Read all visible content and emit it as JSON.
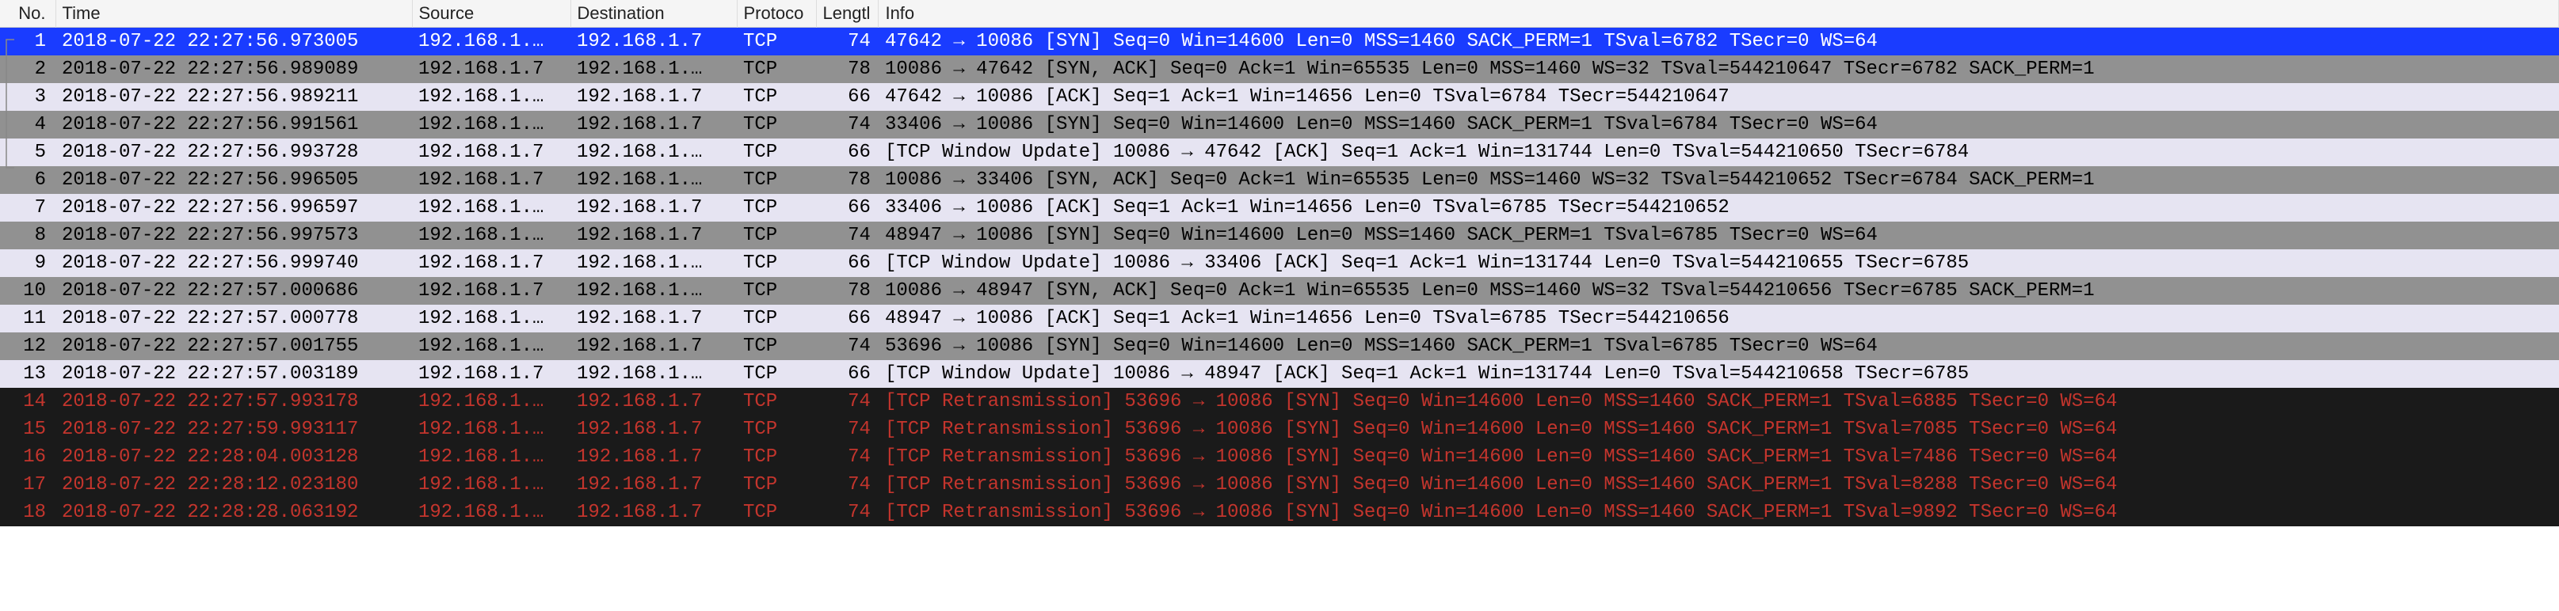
{
  "columns": {
    "no": "No.",
    "time": "Time",
    "source": "Source",
    "destination": "Destination",
    "protocol": "Protoco",
    "length": "Lengtl",
    "info": "Info"
  },
  "rows": [
    {
      "no": "1",
      "time": "2018-07-22 22:27:56.973005",
      "src": "192.168.1.…",
      "dst": "192.168.1.7",
      "proto": "TCP",
      "len": "74",
      "info": "47642 → 10086 [SYN] Seq=0 Win=14600 Len=0 MSS=1460 SACK_PERM=1 TSval=6782 TSecr=0 WS=64",
      "style": "selected"
    },
    {
      "no": "2",
      "time": "2018-07-22 22:27:56.989089",
      "src": "192.168.1.7",
      "dst": "192.168.1.…",
      "proto": "TCP",
      "len": "78",
      "info": "10086 → 47642 [SYN, ACK] Seq=0 Ack=1 Win=65535 Len=0 MSS=1460 WS=32 TSval=544210647 TSecr=6782 SACK_PERM=1",
      "style": "gray"
    },
    {
      "no": "3",
      "time": "2018-07-22 22:27:56.989211",
      "src": "192.168.1.…",
      "dst": "192.168.1.7",
      "proto": "TCP",
      "len": "66",
      "info": "47642 → 10086 [ACK] Seq=1 Ack=1 Win=14656 Len=0 TSval=6784 TSecr=544210647",
      "style": "light"
    },
    {
      "no": "4",
      "time": "2018-07-22 22:27:56.991561",
      "src": "192.168.1.…",
      "dst": "192.168.1.7",
      "proto": "TCP",
      "len": "74",
      "info": "33406 → 10086 [SYN] Seq=0 Win=14600 Len=0 MSS=1460 SACK_PERM=1 TSval=6784 TSecr=0 WS=64",
      "style": "gray"
    },
    {
      "no": "5",
      "time": "2018-07-22 22:27:56.993728",
      "src": "192.168.1.7",
      "dst": "192.168.1.…",
      "proto": "TCP",
      "len": "66",
      "info": "[TCP Window Update] 10086 → 47642 [ACK] Seq=1 Ack=1 Win=131744 Len=0 TSval=544210650 TSecr=6784",
      "style": "light"
    },
    {
      "no": "6",
      "time": "2018-07-22 22:27:56.996505",
      "src": "192.168.1.7",
      "dst": "192.168.1.…",
      "proto": "TCP",
      "len": "78",
      "info": "10086 → 33406 [SYN, ACK] Seq=0 Ack=1 Win=65535 Len=0 MSS=1460 WS=32 TSval=544210652 TSecr=6784 SACK_PERM=1",
      "style": "gray"
    },
    {
      "no": "7",
      "time": "2018-07-22 22:27:56.996597",
      "src": "192.168.1.…",
      "dst": "192.168.1.7",
      "proto": "TCP",
      "len": "66",
      "info": "33406 → 10086 [ACK] Seq=1 Ack=1 Win=14656 Len=0 TSval=6785 TSecr=544210652",
      "style": "light"
    },
    {
      "no": "8",
      "time": "2018-07-22 22:27:56.997573",
      "src": "192.168.1.…",
      "dst": "192.168.1.7",
      "proto": "TCP",
      "len": "74",
      "info": "48947 → 10086 [SYN] Seq=0 Win=14600 Len=0 MSS=1460 SACK_PERM=1 TSval=6785 TSecr=0 WS=64",
      "style": "gray"
    },
    {
      "no": "9",
      "time": "2018-07-22 22:27:56.999740",
      "src": "192.168.1.7",
      "dst": "192.168.1.…",
      "proto": "TCP",
      "len": "66",
      "info": "[TCP Window Update] 10086 → 33406 [ACK] Seq=1 Ack=1 Win=131744 Len=0 TSval=544210655 TSecr=6785",
      "style": "light"
    },
    {
      "no": "10",
      "time": "2018-07-22 22:27:57.000686",
      "src": "192.168.1.7",
      "dst": "192.168.1.…",
      "proto": "TCP",
      "len": "78",
      "info": "10086 → 48947 [SYN, ACK] Seq=0 Ack=1 Win=65535 Len=0 MSS=1460 WS=32 TSval=544210656 TSecr=6785 SACK_PERM=1",
      "style": "gray"
    },
    {
      "no": "11",
      "time": "2018-07-22 22:27:57.000778",
      "src": "192.168.1.…",
      "dst": "192.168.1.7",
      "proto": "TCP",
      "len": "66",
      "info": "48947 → 10086 [ACK] Seq=1 Ack=1 Win=14656 Len=0 TSval=6785 TSecr=544210656",
      "style": "light"
    },
    {
      "no": "12",
      "time": "2018-07-22 22:27:57.001755",
      "src": "192.168.1.…",
      "dst": "192.168.1.7",
      "proto": "TCP",
      "len": "74",
      "info": "53696 → 10086 [SYN] Seq=0 Win=14600 Len=0 MSS=1460 SACK_PERM=1 TSval=6785 TSecr=0 WS=64",
      "style": "gray"
    },
    {
      "no": "13",
      "time": "2018-07-22 22:27:57.003189",
      "src": "192.168.1.7",
      "dst": "192.168.1.…",
      "proto": "TCP",
      "len": "66",
      "info": "[TCP Window Update] 10086 → 48947 [ACK] Seq=1 Ack=1 Win=131744 Len=0 TSval=544210658 TSecr=6785",
      "style": "light"
    },
    {
      "no": "14",
      "time": "2018-07-22 22:27:57.993178",
      "src": "192.168.1.…",
      "dst": "192.168.1.7",
      "proto": "TCP",
      "len": "74",
      "info": "[TCP Retransmission] 53696 → 10086 [SYN] Seq=0 Win=14600 Len=0 MSS=1460 SACK_PERM=1 TSval=6885 TSecr=0 WS=64",
      "style": "retrans"
    },
    {
      "no": "15",
      "time": "2018-07-22 22:27:59.993117",
      "src": "192.168.1.…",
      "dst": "192.168.1.7",
      "proto": "TCP",
      "len": "74",
      "info": "[TCP Retransmission] 53696 → 10086 [SYN] Seq=0 Win=14600 Len=0 MSS=1460 SACK_PERM=1 TSval=7085 TSecr=0 WS=64",
      "style": "retrans"
    },
    {
      "no": "16",
      "time": "2018-07-22 22:28:04.003128",
      "src": "192.168.1.…",
      "dst": "192.168.1.7",
      "proto": "TCP",
      "len": "74",
      "info": "[TCP Retransmission] 53696 → 10086 [SYN] Seq=0 Win=14600 Len=0 MSS=1460 SACK_PERM=1 TSval=7486 TSecr=0 WS=64",
      "style": "retrans"
    },
    {
      "no": "17",
      "time": "2018-07-22 22:28:12.023180",
      "src": "192.168.1.…",
      "dst": "192.168.1.7",
      "proto": "TCP",
      "len": "74",
      "info": "[TCP Retransmission] 53696 → 10086 [SYN] Seq=0 Win=14600 Len=0 MSS=1460 SACK_PERM=1 TSval=8288 TSecr=0 WS=64",
      "style": "retrans"
    },
    {
      "no": "18",
      "time": "2018-07-22 22:28:28.063192",
      "src": "192.168.1.…",
      "dst": "192.168.1.7",
      "proto": "TCP",
      "len": "74",
      "info": "[TCP Retransmission] 53696 → 10086 [SYN] Seq=0 Win=14600 Len=0 MSS=1460 SACK_PERM=1 TSval=9892 TSecr=0 WS=64",
      "style": "retrans"
    }
  ]
}
